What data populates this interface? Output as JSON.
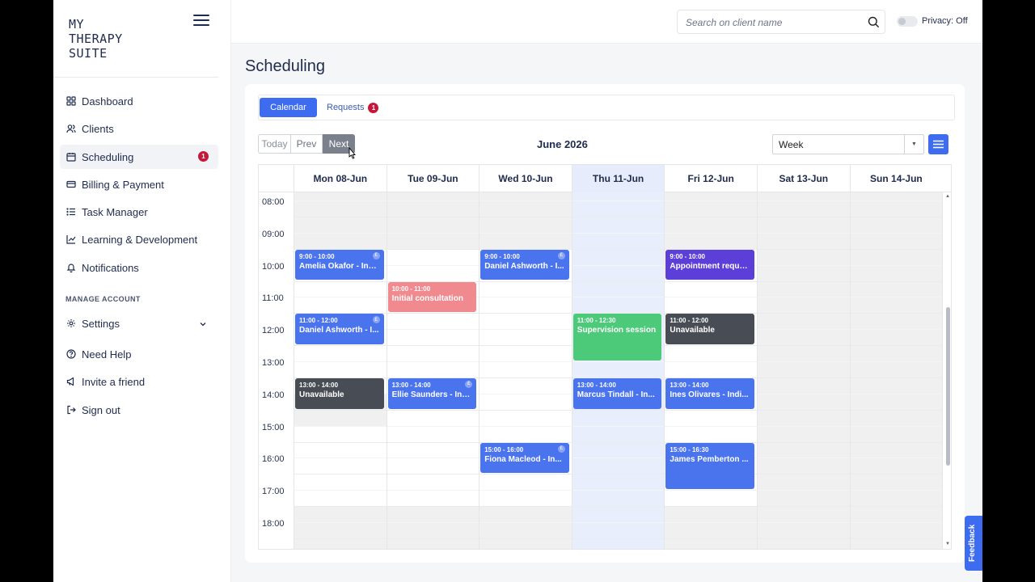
{
  "app": {
    "logo_text": "MY\nTHERAPY\nSUITE"
  },
  "sidebar": {
    "items": [
      {
        "label": "Dashboard",
        "icon": "dashboard-icon"
      },
      {
        "label": "Clients",
        "icon": "users-icon"
      },
      {
        "label": "Scheduling",
        "icon": "calendar-icon",
        "badge": "1",
        "active": true
      },
      {
        "label": "Billing & Payment",
        "icon": "card-icon"
      },
      {
        "label": "Task Manager",
        "icon": "list-icon"
      },
      {
        "label": "Learning & Development",
        "icon": "chart-icon"
      },
      {
        "label": "Notifications",
        "icon": "bell-icon"
      }
    ],
    "section_label": "MANAGE ACCOUNT",
    "account_items": [
      {
        "label": "Settings",
        "icon": "gear-icon"
      },
      {
        "label": "Need Help",
        "icon": "help-icon"
      },
      {
        "label": "Invite a friend",
        "icon": "megaphone-icon"
      },
      {
        "label": "Sign out",
        "icon": "sign-out-icon"
      }
    ]
  },
  "topbar": {
    "search_placeholder": "Search on client name",
    "privacy_label": "Privacy: Off"
  },
  "page": {
    "title": "Scheduling"
  },
  "tabs": {
    "calendar": "Calendar",
    "requests": "Requests",
    "requests_badge": "1"
  },
  "toolbar": {
    "today": "Today",
    "prev": "Prev",
    "next": "Next",
    "month": "June 2026",
    "view": "Week"
  },
  "calendar": {
    "days": [
      "Mon 08-Jun",
      "Tue 09-Jun",
      "Wed 10-Jun",
      "Thu 11-Jun",
      "Fri 12-Jun",
      "Sat 13-Jun",
      "Sun 14-Jun"
    ],
    "today_index": 3,
    "hours": [
      "08:00",
      "09:00",
      "10:00",
      "11:00",
      "12:00",
      "13:00",
      "14:00",
      "15:00",
      "16:00",
      "17:00",
      "18:00"
    ],
    "events": [
      {
        "day": 0,
        "start": 9,
        "end": 10,
        "time": "9:00 - 10:00",
        "title": "Amelia Okafor - Ind...",
        "color": "#4a73ee",
        "pound": true
      },
      {
        "day": 1,
        "start": 10,
        "end": 11,
        "time": "10:00 - 11:00",
        "title": "Initial consultation",
        "color": "#f08a8f",
        "pound": false
      },
      {
        "day": 2,
        "start": 9,
        "end": 10,
        "time": "9:00 - 10:00",
        "title": "Daniel Ashworth - I...",
        "color": "#4a73ee",
        "pound": true
      },
      {
        "day": 4,
        "start": 9,
        "end": 10,
        "time": "9:00 - 10:00",
        "title": "Appointment request",
        "color": "#5b3fd8",
        "pound": false
      },
      {
        "day": 0,
        "start": 11,
        "end": 12,
        "time": "11:00 - 12:00",
        "title": "Daniel Ashworth - I...",
        "color": "#4a73ee",
        "pound": true
      },
      {
        "day": 3,
        "start": 11,
        "end": 12.5,
        "time": "11:00 - 12:30",
        "title": "Supervision session",
        "color": "#4dc97a",
        "pound": false
      },
      {
        "day": 4,
        "start": 11,
        "end": 12,
        "time": "11:00 - 12:00",
        "title": "Unavailable",
        "color": "#474c55",
        "pound": false
      },
      {
        "day": 0,
        "start": 13,
        "end": 14,
        "time": "13:00 - 14:00",
        "title": "Unavailable",
        "color": "#474c55",
        "pound": false
      },
      {
        "day": 1,
        "start": 13,
        "end": 14,
        "time": "13:00 - 14:00",
        "title": "Ellie Saunders - Ind...",
        "color": "#4a73ee",
        "pound": true
      },
      {
        "day": 3,
        "start": 13,
        "end": 14,
        "time": "13:00 - 14:00",
        "title": "Marcus Tindall - In...",
        "color": "#4a73ee",
        "pound": false
      },
      {
        "day": 4,
        "start": 13,
        "end": 14,
        "time": "13:00 - 14:00",
        "title": "Ines Olivares - Indi...",
        "color": "#4a73ee",
        "pound": false
      },
      {
        "day": 2,
        "start": 15,
        "end": 16,
        "time": "15:00 - 16:00",
        "title": "Fiona Macleod - In...",
        "color": "#4a73ee",
        "pound": true
      },
      {
        "day": 4,
        "start": 15,
        "end": 16.5,
        "time": "15:00 - 16:30",
        "title": "James Pemberton ...",
        "color": "#4a73ee",
        "pound": false
      }
    ],
    "pound_symbol": "£"
  },
  "feedback": "Feedback",
  "colors": {
    "accent": "#3d6cf0",
    "badge": "#c4173a",
    "today_column": "#e8eefc"
  }
}
